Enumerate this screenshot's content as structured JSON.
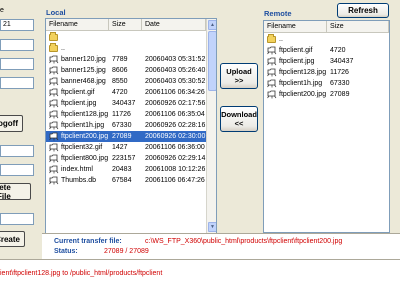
{
  "left_panel": {
    "label_top": "e",
    "port_value": "21",
    "logoff_label": "Logoff",
    "delete_label": "lete File",
    "create_label": "Create"
  },
  "local": {
    "title": "Local",
    "columns": [
      "Filename",
      "Size",
      "Date"
    ],
    "rows": [
      {
        "icon": "folder-icon",
        "name": "",
        "size": "",
        "date": ""
      },
      {
        "icon": "folder-icon",
        "name": "..",
        "size": "",
        "date": ""
      },
      {
        "icon": "file-icon",
        "name": "banner120.jpg",
        "size": "7789",
        "date": "20060403 05:31:52"
      },
      {
        "icon": "file-icon",
        "name": "banner125.jpg",
        "size": "8606",
        "date": "20060403 05:26:40"
      },
      {
        "icon": "file-icon",
        "name": "banner468.jpg",
        "size": "8550",
        "date": "20060403 05:30:52"
      },
      {
        "icon": "file-icon",
        "name": "ftpclient.gif",
        "size": "4720",
        "date": "20061106 06:34:26"
      },
      {
        "icon": "file-icon",
        "name": "ftpclient.jpg",
        "size": "340437",
        "date": "20060926 02:17:56"
      },
      {
        "icon": "file-icon",
        "name": "ftpclient128.jpg",
        "size": "11726",
        "date": "20061106 06:35:04"
      },
      {
        "icon": "file-icon",
        "name": "ftpclient1h.jpg",
        "size": "67330",
        "date": "20060926 02:28:16"
      },
      {
        "icon": "file-icon",
        "name": "ftpclient200.jpg",
        "size": "27089",
        "date": "20060926 02:30:00",
        "selected": true
      },
      {
        "icon": "file-icon",
        "name": "ftpclient32.gif",
        "size": "1427",
        "date": "20061106 06:36:00"
      },
      {
        "icon": "file-icon",
        "name": "ftpclient800.jpg",
        "size": "223157",
        "date": "20060926 02:29:14"
      },
      {
        "icon": "file-icon",
        "name": "index.html",
        "size": "20483",
        "date": "20061008 10:12:26"
      },
      {
        "icon": "file-icon",
        "name": "Thumbs.db",
        "size": "67584",
        "date": "20061106 06:47:26"
      }
    ]
  },
  "remote": {
    "title": "Remote",
    "refresh_label": "Refresh",
    "columns": [
      "Filename",
      "Size"
    ],
    "rows": [
      {
        "icon": "folder-icon",
        "name": "..",
        "size": ""
      },
      {
        "icon": "file-icon",
        "name": "ftpclient.gif",
        "size": "4720"
      },
      {
        "icon": "file-icon",
        "name": "ftpclient.jpg",
        "size": "340437"
      },
      {
        "icon": "file-icon",
        "name": "ftpclient128.jpg",
        "size": "11726"
      },
      {
        "icon": "file-icon",
        "name": "ftpclient1h.jpg",
        "size": "67330"
      },
      {
        "icon": "file-icon",
        "name": "ftpclient200.jpg",
        "size": "27089"
      }
    ]
  },
  "upload": {
    "label": "Upload",
    "arrows": ">>"
  },
  "download": {
    "label": "Download",
    "arrows": "<<"
  },
  "status": {
    "current_label": "Current transfer file:",
    "current_value": "c:\\WS_FTP_X360\\public_html\\products\\ftpclient\\ftpclient200.jpg",
    "status_label": "Status:",
    "status_value": "27089 / 27089"
  },
  "log": {
    "line": "ient\\ftpclient128.jpg to /public_html/products/ftpclient"
  },
  "colors": {
    "accent_blue": "#1F4FA0",
    "status_red": "#D00000",
    "selection": "#316AC5"
  }
}
